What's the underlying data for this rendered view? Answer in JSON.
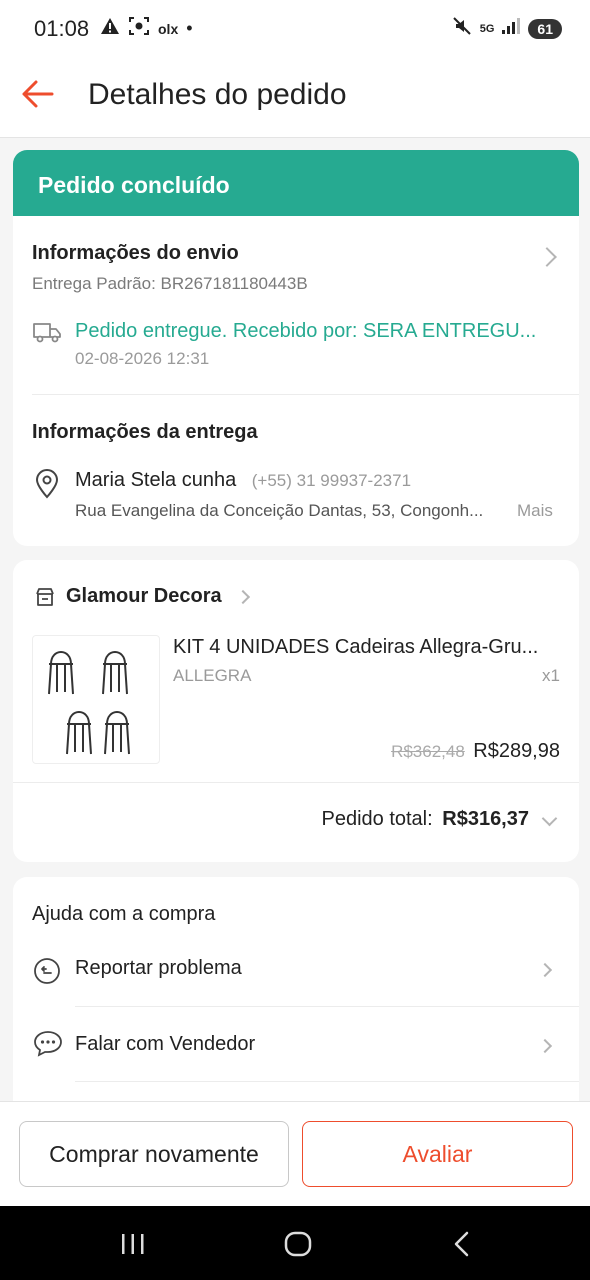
{
  "status_bar": {
    "time": "01:08",
    "app_text": "olx",
    "network": "5G",
    "battery": "61"
  },
  "header": {
    "title": "Detalhes do pedido"
  },
  "order_status": {
    "label": "Pedido concluído"
  },
  "shipping": {
    "title": "Informações do envio",
    "method": "Entrega Padrão: BR267181180443B",
    "tracking_status": "Pedido entregue. Recebido por: SERA ENTREGU...",
    "tracking_time": "02-08-2026 12:31"
  },
  "delivery": {
    "title": "Informações da entrega",
    "recipient": "Maria Stela cunha",
    "phone": "(+55) 31 99937-2371",
    "address": "Rua Evangelina da Conceição Dantas, 53, Congonh...",
    "more": "Mais"
  },
  "shop": {
    "name": "Glamour Decora"
  },
  "product": {
    "title": "KIT 4 UNIDADES Cadeiras Allegra-Gru...",
    "variant": "ALLEGRA",
    "quantity": "x1",
    "original_price": "R$362,48",
    "price": "R$289,98"
  },
  "order_total": {
    "label": "Pedido total:",
    "value": "R$316,37"
  },
  "help": {
    "title": "Ajuda com a compra",
    "items": [
      {
        "label": "Reportar problema"
      },
      {
        "label": "Falar com Vendedor"
      }
    ]
  },
  "actions": {
    "buy_again": "Comprar novamente",
    "rate": "Avaliar"
  },
  "colors": {
    "accent_orange": "#ee4d2d",
    "success_teal": "#26aa91"
  }
}
